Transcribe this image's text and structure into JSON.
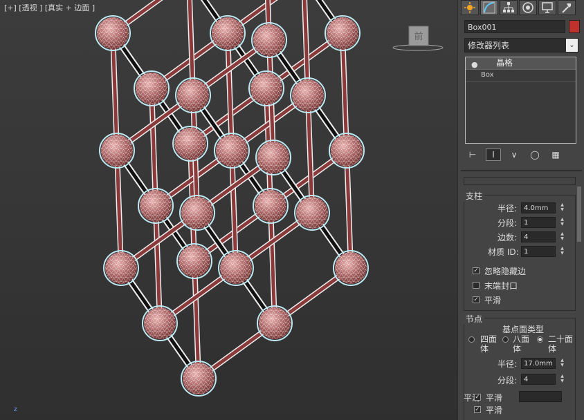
{
  "viewport": {
    "label": "[+] [透视 ] [真实 + 边面 ]",
    "viewcube_face": "前",
    "axis_label": "z"
  },
  "panel": {
    "tabs": [
      "sun-icon",
      "curve-icon",
      "hierarchy-icon",
      "motion-icon",
      "display-icon",
      "hammer-icon"
    ],
    "object_name": "Box001",
    "object_color": "#c0312e",
    "modifier_list": "修改器列表",
    "stack_items": [
      "晶格",
      "Box"
    ],
    "struts": {
      "title": "支柱",
      "radius_label": "半径:",
      "radius_value": "4.0mm",
      "segments_label": "分段:",
      "segments_value": "1",
      "sides_label": "边数:",
      "sides_value": "4",
      "material_label": "材质 ID:",
      "material_value": "1",
      "ignore_hidden": "忽略隐藏边",
      "end_caps": "末端封口",
      "smooth": "平滑"
    },
    "joints": {
      "title": "节点",
      "geodesic_label": "基点面类型",
      "tetra": "四面体",
      "octa": "八面体",
      "icosa": "二十面体",
      "radius_label": "半径:",
      "radius_value": "17.0mm",
      "segments_label": "分段:",
      "segments_value": "4",
      "overlap_label": "平滑",
      "smooth_label": "平滑",
      "smooth2_label": "平滑"
    }
  }
}
